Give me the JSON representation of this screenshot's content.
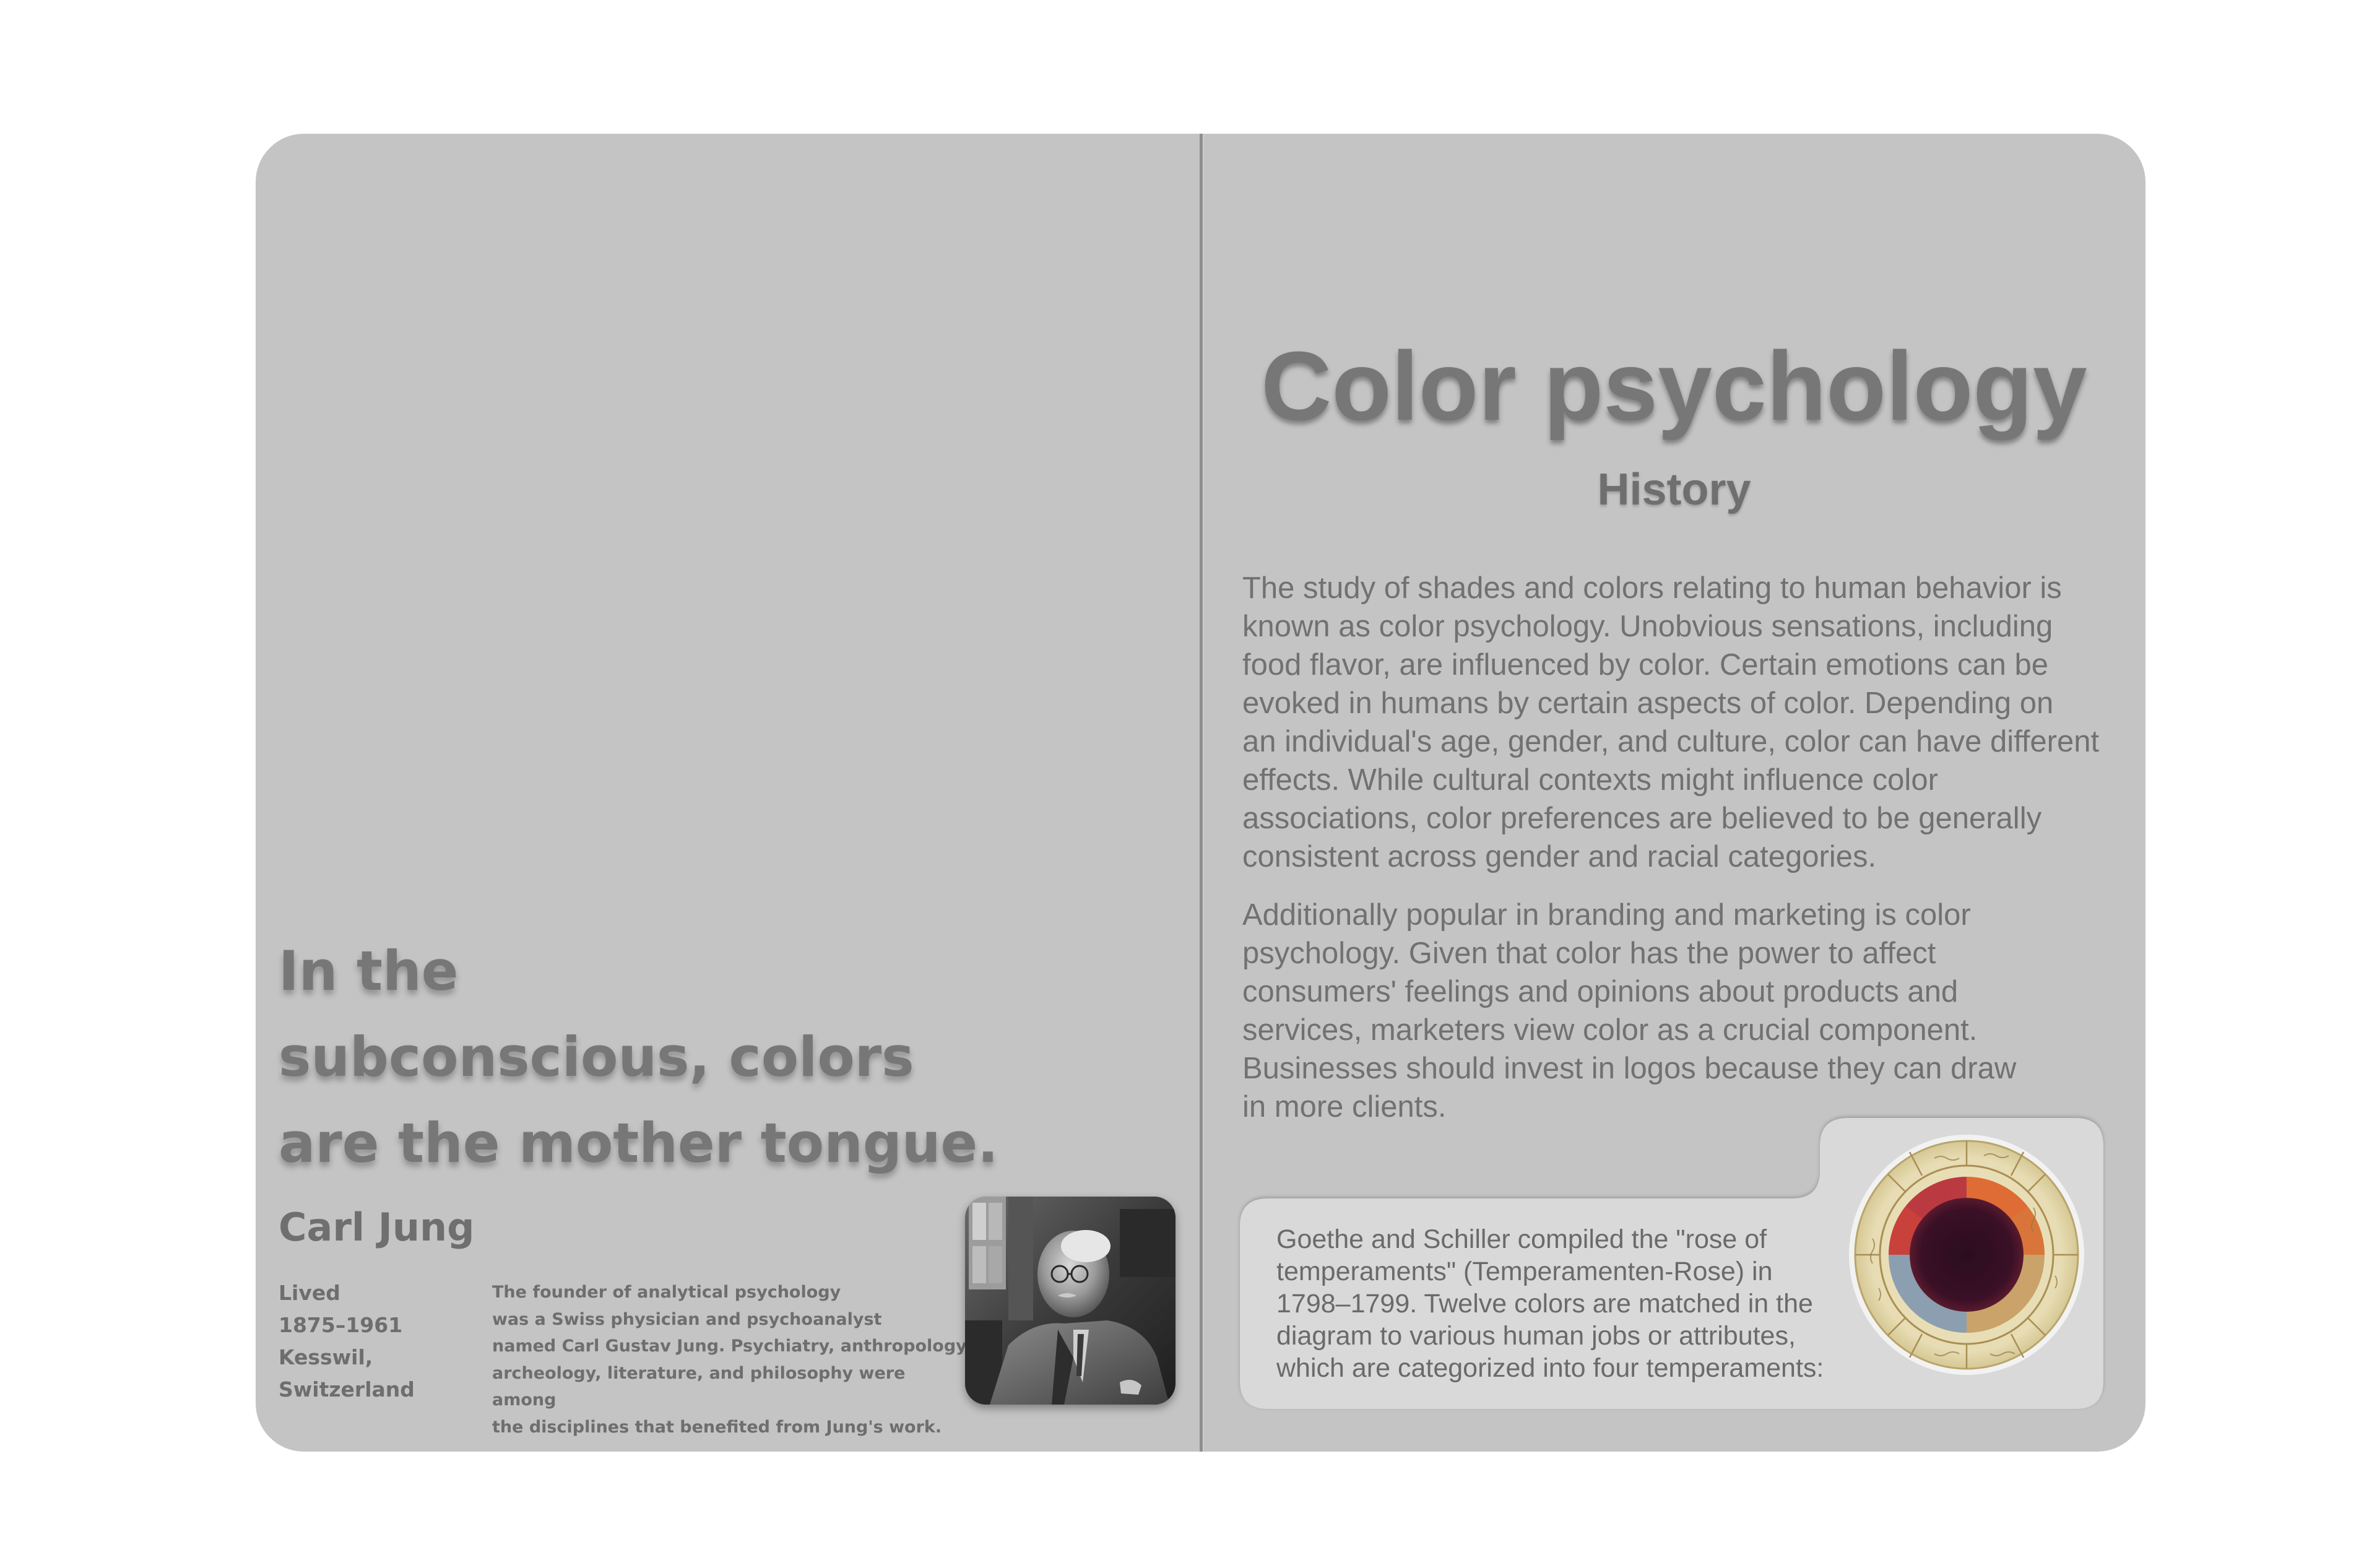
{
  "left_page": {
    "quote_lines": [
      "In the",
      "subconscious, colors",
      "are the mother tongue."
    ],
    "author": "Carl Jung",
    "lived": {
      "label": "Lived",
      "years": "1875–1961",
      "place_line1": "Kesswil,",
      "place_line2": "Switzerland"
    },
    "bio_lines": [
      "The founder of analytical psychology",
      "was a Swiss physician and psychoanalyst",
      "named Carl Gustav Jung. Psychiatry, anthropology,",
      "archeology, literature, and philosophy were among",
      "the disciplines that benefited from Jung's work."
    ]
  },
  "right_page": {
    "title": "Color psychology",
    "subtitle": "History",
    "paragraph1_lines": [
      "The study of shades and colors relating to human behavior is",
      "known as color psychology. Unobvious sensations, including",
      "food flavor, are influenced by color. Certain emotions can be",
      "evoked in humans by certain aspects of color. Depending on",
      "an individual's age, gender, and culture, color can have different",
      "effects. While cultural contexts might influence color",
      "associations, color preferences are believed to be generally",
      "consistent across gender and racial categories."
    ],
    "paragraph2_lines": [
      "Additionally popular in branding and marketing is color",
      "psychology. Given that color has the power to affect",
      "consumers' feelings and opinions about products and",
      "services, marketers view color as a crucial component.",
      "Businesses should invest in logos because they can draw",
      "in more clients."
    ],
    "card_lines": [
      "Goethe and Schiller compiled the \"rose of",
      "temperaments\" (Temperamenten-Rose) in",
      "1798–1799. Twelve colors are matched in the",
      "diagram to various human jobs or attributes,",
      "which are categorized into four temperaments:"
    ]
  },
  "colors": {
    "page_background": "#c4c4c4",
    "card_background": "#d9d9d9",
    "heading_text": "#777777",
    "body_text": "#717171"
  },
  "icons": {
    "portrait": "photo-of-carl-jung",
    "rose": "rose-of-temperaments-wheel"
  }
}
